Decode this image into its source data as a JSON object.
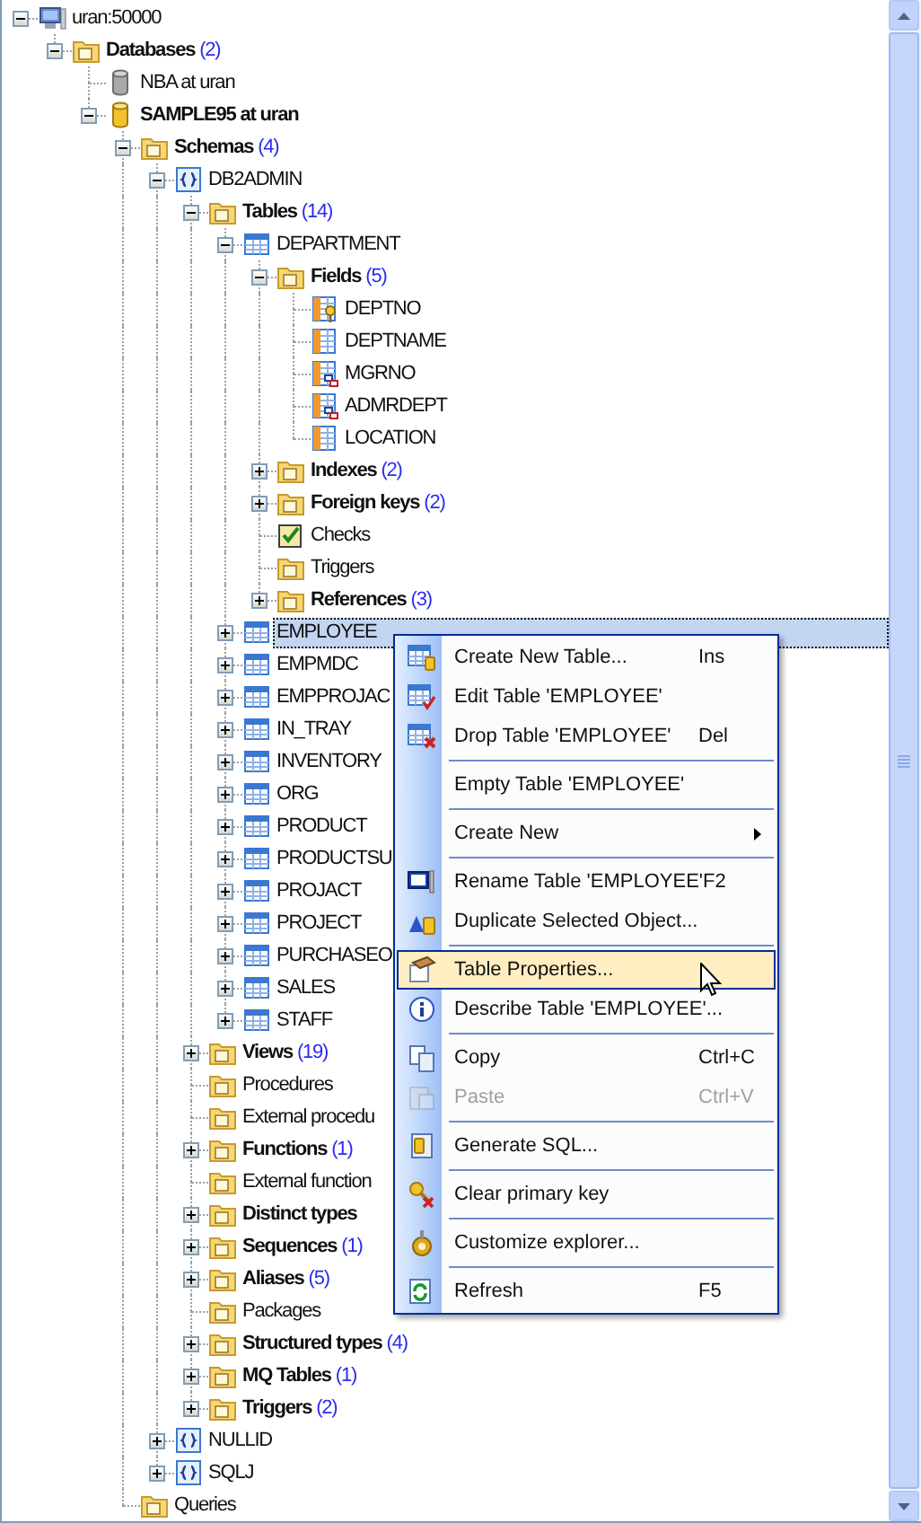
{
  "tree": [
    {
      "label": "uran:50000",
      "kind": "server",
      "expanded": true,
      "selected": false,
      "children": [
        {
          "label": "Databases",
          "count": "(2)",
          "kind": "folder",
          "expanded": true,
          "selected": false,
          "children": [
            {
              "label": "NBA at uran",
              "kind": "database",
              "connected": false,
              "selected": false
            },
            {
              "label": "SAMPLE95 at uran",
              "kind": "database",
              "connected": true,
              "expanded": true,
              "selected": false,
              "children": [
                {
                  "label": "Schemas",
                  "count": "(4)",
                  "kind": "folder",
                  "expanded": true,
                  "selected": false,
                  "children": [
                    {
                      "label": "DB2ADMIN",
                      "kind": "schema",
                      "expanded": true,
                      "selected": false,
                      "children": [
                        {
                          "label": "Tables",
                          "count": "(14)",
                          "kind": "folder",
                          "expanded": true,
                          "selected": false,
                          "children": [
                            {
                              "label": "DEPARTMENT",
                              "kind": "table",
                              "expanded": true,
                              "selected": false,
                              "children": [
                                {
                                  "label": "Fields",
                                  "count": "(5)",
                                  "kind": "folder",
                                  "expanded": true,
                                  "selected": false,
                                  "children": [
                                    {
                                      "label": "DEPTNO",
                                      "kind": "key-field",
                                      "selected": false
                                    },
                                    {
                                      "label": "DEPTNAME",
                                      "kind": "field",
                                      "selected": false
                                    },
                                    {
                                      "label": "MGRNO",
                                      "kind": "link-field",
                                      "selected": false
                                    },
                                    {
                                      "label": "ADMRDEPT",
                                      "kind": "link-field",
                                      "selected": false
                                    },
                                    {
                                      "label": "LOCATION",
                                      "kind": "field",
                                      "selected": false
                                    }
                                  ]
                                },
                                {
                                  "label": "Indexes",
                                  "count": "(2)",
                                  "kind": "folder",
                                  "expanded": false,
                                  "selected": false
                                },
                                {
                                  "label": "Foreign keys",
                                  "count": "(2)",
                                  "kind": "folder",
                                  "expanded": false,
                                  "selected": false
                                },
                                {
                                  "label": "Checks",
                                  "kind": "checks",
                                  "selected": false
                                },
                                {
                                  "label": "Triggers",
                                  "kind": "folder",
                                  "selected": false
                                },
                                {
                                  "label": "References",
                                  "count": "(3)",
                                  "kind": "folder",
                                  "expanded": false,
                                  "selected": false
                                }
                              ]
                            },
                            {
                              "label": "EMPLOYEE",
                              "kind": "table",
                              "expanded": false,
                              "selected": true
                            },
                            {
                              "label": "EMPMDC",
                              "kind": "table",
                              "expanded": false,
                              "selected": false
                            },
                            {
                              "label": "EMPPROJAC",
                              "kind": "table",
                              "expanded": false,
                              "selected": false
                            },
                            {
                              "label": "IN_TRAY",
                              "kind": "table",
                              "expanded": false,
                              "selected": false
                            },
                            {
                              "label": "INVENTORY",
                              "kind": "table",
                              "expanded": false,
                              "selected": false
                            },
                            {
                              "label": "ORG",
                              "kind": "table",
                              "expanded": false,
                              "selected": false
                            },
                            {
                              "label": "PRODUCT",
                              "kind": "table",
                              "expanded": false,
                              "selected": false
                            },
                            {
                              "label": "PRODUCTSU",
                              "kind": "table",
                              "expanded": false,
                              "selected": false
                            },
                            {
                              "label": "PROJACT",
                              "kind": "table",
                              "expanded": false,
                              "selected": false
                            },
                            {
                              "label": "PROJECT",
                              "kind": "table",
                              "expanded": false,
                              "selected": false
                            },
                            {
                              "label": "PURCHASEO",
                              "kind": "table",
                              "expanded": false,
                              "selected": false
                            },
                            {
                              "label": "SALES",
                              "kind": "table",
                              "expanded": false,
                              "selected": false
                            },
                            {
                              "label": "STAFF",
                              "kind": "table",
                              "expanded": false,
                              "selected": false
                            }
                          ]
                        },
                        {
                          "label": "Views",
                          "count": "(19)",
                          "kind": "folder",
                          "expanded": false,
                          "selected": false
                        },
                        {
                          "label": "Procedures",
                          "kind": "folder",
                          "selected": false
                        },
                        {
                          "label": "External procedu",
                          "kind": "folder",
                          "selected": false
                        },
                        {
                          "label": "Functions",
                          "count": "(1)",
                          "kind": "folder",
                          "expanded": false,
                          "selected": false
                        },
                        {
                          "label": "External function",
                          "kind": "folder",
                          "selected": false
                        },
                        {
                          "label": "Distinct types",
                          "kind": "folder",
                          "expanded": false,
                          "selected": false
                        },
                        {
                          "label": "Sequences",
                          "count": "(1)",
                          "kind": "folder",
                          "expanded": false,
                          "selected": false
                        },
                        {
                          "label": "Aliases",
                          "count": "(5)",
                          "kind": "folder",
                          "expanded": false,
                          "selected": false
                        },
                        {
                          "label": "Packages",
                          "kind": "folder",
                          "selected": false
                        },
                        {
                          "label": "Structured types",
                          "count": "(4)",
                          "kind": "folder",
                          "expanded": false,
                          "selected": false
                        },
                        {
                          "label": "MQ Tables",
                          "count": "(1)",
                          "kind": "folder",
                          "expanded": false,
                          "selected": false
                        },
                        {
                          "label": "Triggers",
                          "count": "(2)",
                          "kind": "folder",
                          "expanded": false,
                          "selected": false
                        }
                      ]
                    },
                    {
                      "label": "NULLID",
                      "kind": "schema",
                      "expanded": false,
                      "selected": false
                    },
                    {
                      "label": "SQLJ",
                      "kind": "schema",
                      "expanded": false,
                      "selected": false
                    }
                  ]
                },
                {
                  "label": "Queries",
                  "kind": "folder",
                  "selected": false
                }
              ]
            }
          ]
        }
      ]
    }
  ],
  "context_menu": [
    {
      "kind": "item",
      "label": "Create New Table...",
      "shortcut": "Ins",
      "disabled": false,
      "selected": false
    },
    {
      "kind": "item",
      "label": "Edit Table 'EMPLOYEE'",
      "disabled": false,
      "selected": false
    },
    {
      "kind": "item",
      "label": "Drop Table 'EMPLOYEE'",
      "shortcut": "Del",
      "disabled": false,
      "selected": false
    },
    {
      "kind": "separator"
    },
    {
      "kind": "item",
      "label": "Empty Table 'EMPLOYEE'",
      "disabled": false,
      "selected": false
    },
    {
      "kind": "separator"
    },
    {
      "kind": "submenu",
      "label": "Create New",
      "disabled": false,
      "selected": false
    },
    {
      "kind": "separator"
    },
    {
      "kind": "item",
      "label": "Rename Table 'EMPLOYEE'",
      "shortcut": "F2",
      "disabled": false,
      "selected": false
    },
    {
      "kind": "item",
      "label": "Duplicate Selected Object...",
      "disabled": false,
      "selected": false
    },
    {
      "kind": "separator"
    },
    {
      "kind": "item",
      "label": "Table Properties...",
      "disabled": false,
      "selected": true
    },
    {
      "kind": "item",
      "label": "Describe Table 'EMPLOYEE'...",
      "disabled": false,
      "selected": false
    },
    {
      "kind": "separator"
    },
    {
      "kind": "item",
      "label": "Copy",
      "shortcut": "Ctrl+C",
      "disabled": false,
      "selected": false
    },
    {
      "kind": "item",
      "label": "Paste",
      "shortcut": "Ctrl+V",
      "disabled": true,
      "selected": false
    },
    {
      "kind": "separator"
    },
    {
      "kind": "item",
      "label": "Generate SQL...",
      "disabled": false,
      "selected": false
    },
    {
      "kind": "separator"
    },
    {
      "kind": "item",
      "label": "Clear primary key",
      "disabled": false,
      "selected": false
    },
    {
      "kind": "separator"
    },
    {
      "kind": "item",
      "label": "Customize explorer...",
      "disabled": false,
      "selected": false
    },
    {
      "kind": "separator"
    },
    {
      "kind": "item",
      "label": "Refresh",
      "shortcut": "F5",
      "disabled": false,
      "selected": false
    }
  ]
}
